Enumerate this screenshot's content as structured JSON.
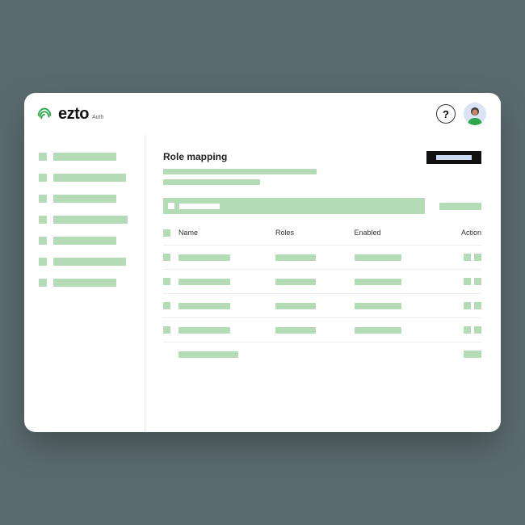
{
  "brand": {
    "name": "ezto",
    "sub": "Auth"
  },
  "topbar": {
    "help_label": "?",
    "avatar_alt": "User avatar"
  },
  "sidebar": {
    "items": [
      {
        "icon": "nav-icon",
        "label_width": 78
      },
      {
        "icon": "nav-icon",
        "label_width": 90
      },
      {
        "icon": "nav-icon",
        "label_width": 78
      },
      {
        "icon": "nav-icon",
        "label_width": 92
      },
      {
        "icon": "nav-icon",
        "label_width": 78
      },
      {
        "icon": "nav-icon",
        "label_width": 90
      },
      {
        "icon": "nav-icon",
        "label_width": 78
      }
    ]
  },
  "page": {
    "title": "Role mapping",
    "primary_button_label": "",
    "subtitle_placeholder_1": "",
    "subtitle_placeholder_2": "",
    "filter_placeholder": "",
    "secondary_button_label": ""
  },
  "table": {
    "columns": {
      "name": "Name",
      "roles": "Roles",
      "enabled": "Enabled",
      "action": "Action"
    },
    "rows": [
      {
        "name": "",
        "roles": "",
        "enabled": "",
        "action": ""
      },
      {
        "name": "",
        "roles": "",
        "enabled": "",
        "action": ""
      },
      {
        "name": "",
        "roles": "",
        "enabled": "",
        "action": ""
      },
      {
        "name": "",
        "roles": "",
        "enabled": "",
        "action": ""
      },
      {
        "name": "",
        "roles": "",
        "enabled": "",
        "action": ""
      }
    ]
  },
  "colors": {
    "accent": "#b2dbb6",
    "logo_green": "#2aa84a"
  }
}
